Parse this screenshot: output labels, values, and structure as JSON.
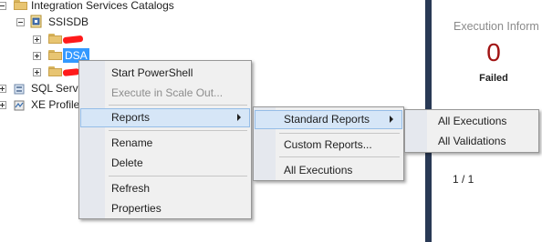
{
  "tree": {
    "catalogs_label": "Integration Services Catalogs",
    "ssisdb_label": "SSISDB",
    "folder_dsa_label": "DSA",
    "sql_server_label": "SQL Server",
    "xe_profiler_label": "XE Profiler"
  },
  "report_panel": {
    "title": "Execution Inform",
    "failed_count": "0",
    "failed_label": "Failed",
    "page_indicator": "1 / 1"
  },
  "context_menu": {
    "items": [
      {
        "label": "Start PowerShell"
      },
      {
        "label": "Execute in Scale Out..."
      },
      {
        "label": "Reports"
      },
      {
        "label": "Rename"
      },
      {
        "label": "Delete"
      },
      {
        "label": "Refresh"
      },
      {
        "label": "Properties"
      }
    ]
  },
  "reports_submenu": {
    "items": [
      {
        "label": "Standard Reports"
      },
      {
        "label": "Custom Reports..."
      },
      {
        "label": "All Executions"
      }
    ]
  },
  "standard_reports_submenu": {
    "items": [
      {
        "label": "All Executions"
      },
      {
        "label": "All Validations"
      }
    ]
  },
  "colors": {
    "selection": "#3399ff",
    "menu_highlight": "#d6e6f7",
    "failed_count": "#a11414",
    "splitter": "#293955",
    "redaction": "#ff1a1a"
  },
  "icons": [
    "collapse-icon",
    "expand-icon",
    "folder-icon",
    "database-icon"
  ]
}
